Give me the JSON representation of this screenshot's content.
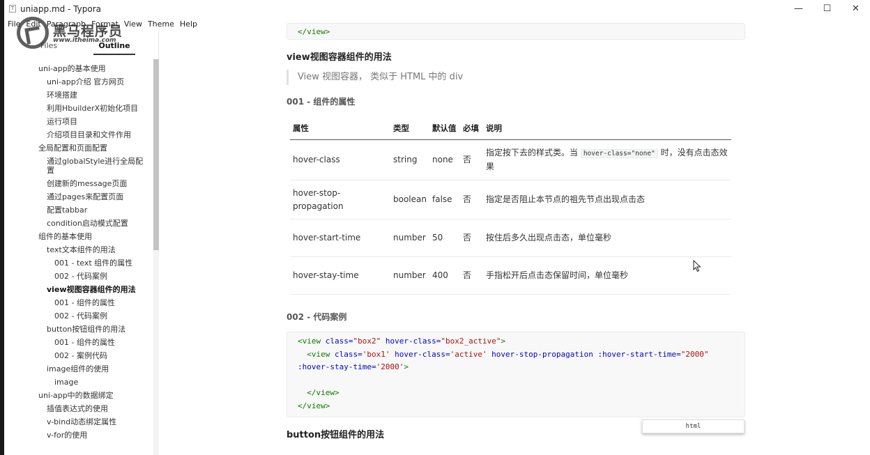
{
  "window": {
    "title": "uniapp.md - Typora",
    "icon_letter": "T",
    "minimize": "—",
    "maximize": "☐",
    "close": "✕"
  },
  "menu": [
    "File",
    "Edit",
    "Paragraph",
    "Format",
    "View",
    "Theme",
    "Help"
  ],
  "watermark": {
    "title": "黑马程序员",
    "url": "www.itheima.com"
  },
  "sidebar": {
    "tab_files": "Files",
    "tab_outline": "Outline",
    "outline": [
      {
        "level": 1,
        "text": "uni-app的基本使用"
      },
      {
        "level": 2,
        "text": "uni-app介绍 官方网页"
      },
      {
        "level": 2,
        "text": "环境搭建"
      },
      {
        "level": 2,
        "text": "利用HbuilderX初始化项目"
      },
      {
        "level": 2,
        "text": "运行项目"
      },
      {
        "level": 2,
        "text": "介绍项目目录和文件作用"
      },
      {
        "level": 1,
        "text": "全局配置和页面配置"
      },
      {
        "level": 2,
        "text": "通过globalStyle进行全局配置"
      },
      {
        "level": 2,
        "text": "创建新的message页面"
      },
      {
        "level": 2,
        "text": "通过pages来配置页面"
      },
      {
        "level": 2,
        "text": "配置tabbar"
      },
      {
        "level": 2,
        "text": "condition启动模式配置"
      },
      {
        "level": 1,
        "text": "组件的基本使用"
      },
      {
        "level": 2,
        "text": "text文本组件的用法"
      },
      {
        "level": 3,
        "text": "001 - text 组件的属性"
      },
      {
        "level": 3,
        "text": "002 - 代码案例"
      },
      {
        "level": 2,
        "text": "view视图容器组件的用法",
        "active": true
      },
      {
        "level": 3,
        "text": "001 - 组件的属性"
      },
      {
        "level": 3,
        "text": "002 - 代码案例"
      },
      {
        "level": 2,
        "text": "button按钮组件的用法"
      },
      {
        "level": 3,
        "text": "001 - 组件的属性"
      },
      {
        "level": 3,
        "text": "002 - 案例代码"
      },
      {
        "level": 2,
        "text": "image组件的使用"
      },
      {
        "level": 3,
        "text": "image"
      },
      {
        "level": 1,
        "text": "uni-app中的数据绑定"
      },
      {
        "level": 2,
        "text": "插值表达式的使用"
      },
      {
        "level": 2,
        "text": "v-bind动态绑定属性"
      },
      {
        "level": 2,
        "text": "v-for的使用"
      }
    ]
  },
  "doc": {
    "code_top_line": "</view>",
    "h3_view": "view视图容器组件的用法",
    "quote": "View 视图容器， 类似于 HTML 中的 div",
    "h4_props": "001 - 组件的属性",
    "table": {
      "headers": [
        "属性",
        "类型",
        "默认值",
        "必填",
        "说明"
      ],
      "rows": [
        [
          "hover-class",
          "string",
          "none",
          "否"
        ],
        [
          "hover-stop-propagation",
          "boolean",
          "false",
          "否",
          "指定是否阻止本节点的祖先节点出现点击态"
        ],
        [
          "hover-start-time",
          "number",
          "50",
          "否",
          "按住后多久出现点击态，单位毫秒"
        ],
        [
          "hover-stay-time",
          "number",
          "400",
          "否",
          "手指松开后点击态保留时间，单位毫秒"
        ]
      ],
      "row1_desc_before": "指定按下去的样式类。当 ",
      "row1_desc_code": "hover-class=\"none\"",
      "row1_desc_after": " 时，没有点击态效果"
    },
    "h4_code": "002 - 代码案例",
    "code": {
      "l1_open": "<view ",
      "l1_a1": "class=",
      "l1_v1": "\"box2\"",
      "l1_a2": " hover-class=",
      "l1_v2": "\"box2_active\"",
      "l1_close": ">",
      "l2_open": "  <view ",
      "l2_a1": "class=",
      "l2_v1": "'box1'",
      "l2_a2": " hover-class=",
      "l2_v2": "'active'",
      "l2_a3": " hover-stop-propagation :hover-start-time=",
      "l2_v3": "\"2000\"",
      "l3_a": ":hover-stay-time=",
      "l3_v": "'2000'",
      "l3_close": ">",
      "l5": "  </view>",
      "l6": "</view>"
    },
    "h3_button": "button按钮组件的用法",
    "lang_tag": "html"
  }
}
